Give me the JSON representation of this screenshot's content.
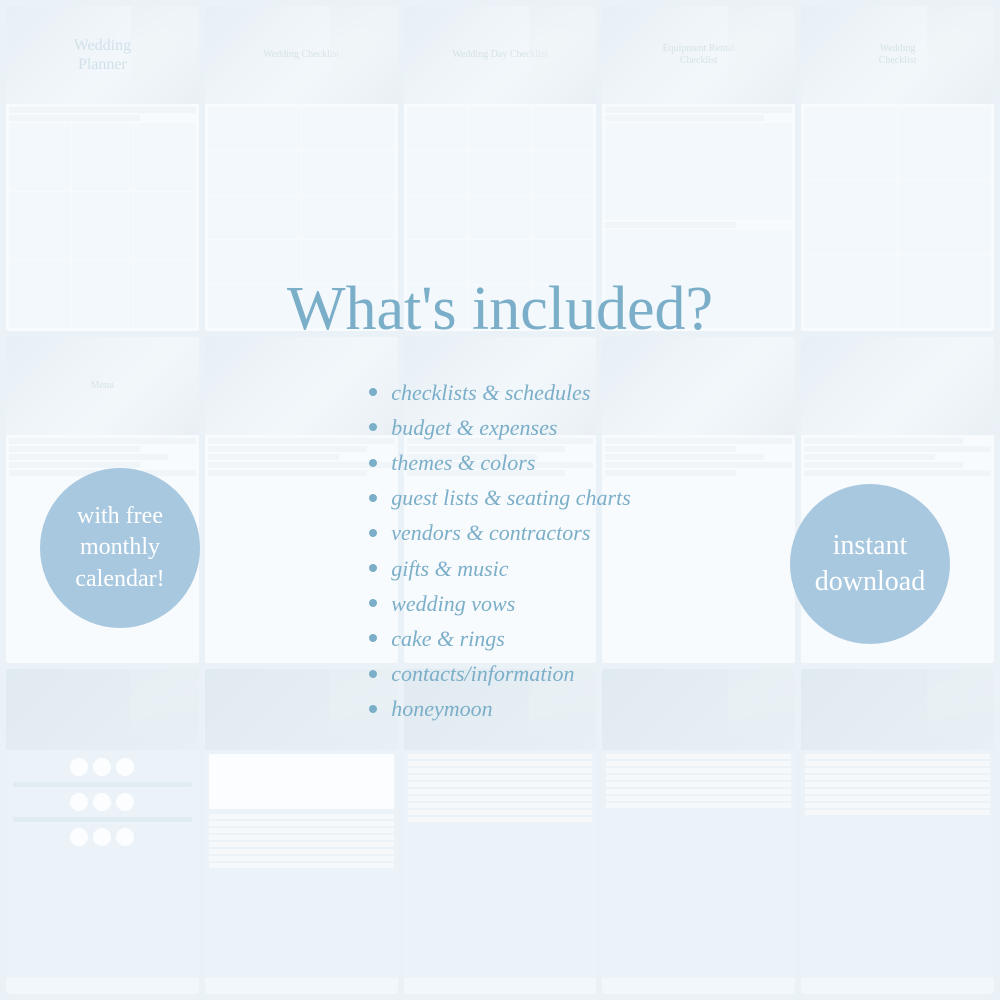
{
  "page": {
    "title": "Wedding Planner - What's included?",
    "background_color": "#b8cfe0"
  },
  "header": {
    "title": "What's included?"
  },
  "included_items": [
    "checklists & schedules",
    "budget & expenses",
    "themes & colors",
    "guest lists & seating charts",
    "vendors & contractors",
    "gifts & music",
    "wedding vows",
    "cake & rings",
    "contacts/information",
    "honeymoon"
  ],
  "badge_left": {
    "text": "with free\nmonthly\ncalendar!"
  },
  "badge_right": {
    "text": "instant\ndownload"
  },
  "thumbnails": {
    "row1": [
      {
        "title": "Wedding\nPlanner"
      },
      {
        "title": "Wedding Checklist"
      },
      {
        "title": "Wedding Day Checklist"
      },
      {
        "title": "Equipment Rental\nChecklist"
      },
      {
        "title": "Wedding\nChecklist"
      }
    ],
    "row2": [
      {
        "title": "Menu"
      },
      {
        "title": ""
      },
      {
        "title": ""
      },
      {
        "title": ""
      },
      {
        "title": ""
      }
    ],
    "row3": [
      {
        "title": ""
      },
      {
        "title": ""
      },
      {
        "title": ""
      },
      {
        "title": ""
      },
      {
        "title": ""
      }
    ]
  }
}
